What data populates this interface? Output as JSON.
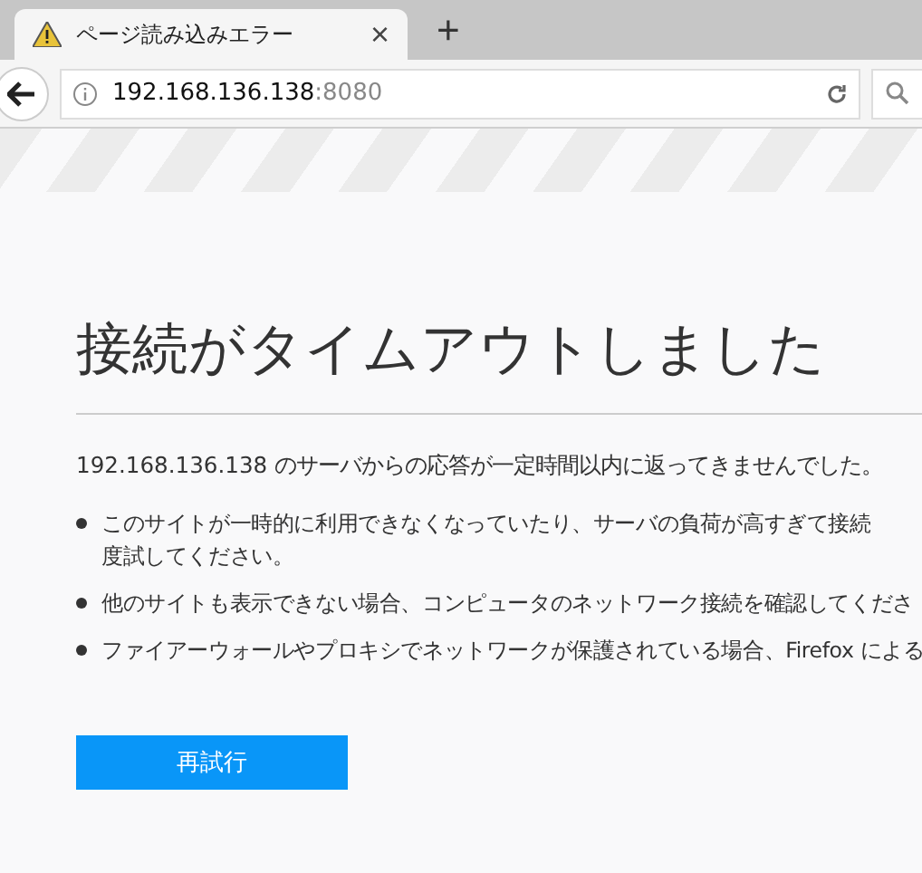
{
  "tab": {
    "title": "ページ読み込みエラー",
    "close": "×",
    "selected": true
  },
  "new_tab": "+",
  "address": {
    "host": "192.168.136.138",
    "port": ":8080"
  },
  "title": "接続がタイムアウトしました",
  "description": "192.168.136.138 のサーバからの応答が一定時間以内に返ってきませんでした。",
  "bullets": [
    {
      "lines": [
        "このサイトが一時的に利用できなくなっていたり、サーバの負荷が高すぎて接続",
        "度試してください。"
      ]
    },
    {
      "lines": [
        "他のサイトも表示できない場合、コンピュータのネットワーク接続を確認してくださ"
      ]
    },
    {
      "lines": [
        "ファイアーウォールやプロキシでネットワークが保護されている場合、Firefox による"
      ]
    }
  ],
  "retry_button": "再試行"
}
